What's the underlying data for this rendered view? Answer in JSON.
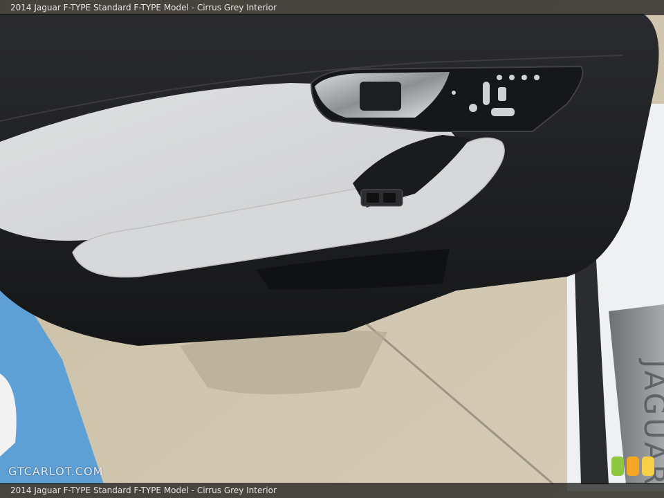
{
  "caption": {
    "top": "2014 Jaguar F-TYPE Standard F-TYPE Model - Cirrus Grey Interior",
    "bottom": "2014 Jaguar F-TYPE Standard F-TYPE Model - Cirrus Grey Interior"
  },
  "watermark": "GTCARLOT.COM",
  "sill_plate_text": "JAGUAR",
  "colors": {
    "door_dark": "#1c1d20",
    "door_leather_light": "#d9dadb",
    "ground": "#cfc4ad",
    "parking_blue": "#5ea0d6",
    "car_body_white": "#eef0f1",
    "thumb_green": "#8dc63f",
    "thumb_orange": "#f5a623",
    "thumb_yellow": "#f7d046"
  }
}
